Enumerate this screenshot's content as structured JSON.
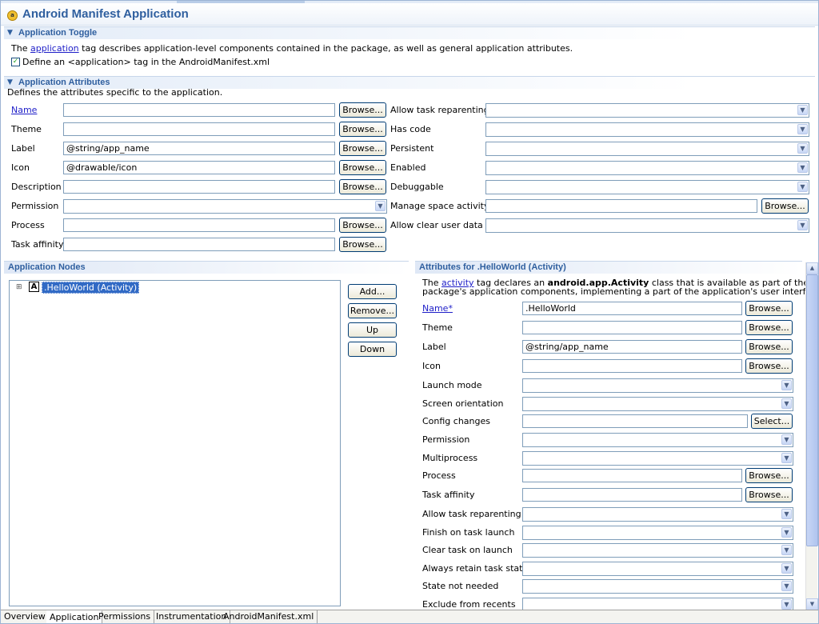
{
  "title": "Android Manifest Application",
  "toggle": {
    "header": "Application Toggle",
    "desc_pre": "The",
    "desc_link": "application",
    "desc_post": "tag describes application-level components contained in the package, as well as general application attributes.",
    "checkbox_label": "Define an <application> tag in the AndroidManifest.xml",
    "checked": true
  },
  "attrs": {
    "header": "Application Attributes",
    "desc": "Defines the attributes specific to the application.",
    "browse": "Browse...",
    "left": [
      {
        "label": "Name",
        "value": "",
        "kind": "text",
        "link": true
      },
      {
        "label": "Theme",
        "value": "",
        "kind": "text"
      },
      {
        "label": "Label",
        "value": "@string/app_name",
        "kind": "text"
      },
      {
        "label": "Icon",
        "value": "@drawable/icon",
        "kind": "text"
      },
      {
        "label": "Description",
        "value": "",
        "kind": "text"
      },
      {
        "label": "Permission",
        "value": "",
        "kind": "combo"
      },
      {
        "label": "Process",
        "value": "",
        "kind": "text"
      },
      {
        "label": "Task affinity",
        "value": "",
        "kind": "text"
      }
    ],
    "right": [
      {
        "label": "Allow task reparenting",
        "value": "",
        "kind": "combo"
      },
      {
        "label": "Has code",
        "value": "",
        "kind": "combo"
      },
      {
        "label": "Persistent",
        "value": "",
        "kind": "combo"
      },
      {
        "label": "Enabled",
        "value": "",
        "kind": "combo"
      },
      {
        "label": "Debuggable",
        "value": "",
        "kind": "combo"
      },
      {
        "label": "Manage space activity",
        "value": "",
        "kind": "text"
      },
      {
        "label": "Allow clear user data",
        "value": "",
        "kind": "combo"
      }
    ]
  },
  "nodes": {
    "header": "Application Nodes",
    "tree_item": ".HelloWorld (Activity)",
    "tree_badge": "A",
    "buttons": {
      "add": "Add...",
      "remove": "Remove...",
      "up": "Up",
      "down": "Down"
    }
  },
  "activity": {
    "header": "Attributes for .HelloWorld (Activity)",
    "desc1_pre": "The",
    "desc1_link": "activity",
    "desc1_mid": "tag declares an",
    "desc1_bold": "android.app.Activity",
    "desc1_post": "class that is available as part of the",
    "desc2": "package's application components, implementing a part of the application's user interface.",
    "browse": "Browse...",
    "select": "Select...",
    "fields": [
      {
        "label": "Name*",
        "value": ".HelloWorld",
        "kind": "text",
        "link": true
      },
      {
        "label": "Theme",
        "value": "",
        "kind": "text"
      },
      {
        "label": "Label",
        "value": "@string/app_name",
        "kind": "text"
      },
      {
        "label": "Icon",
        "value": "",
        "kind": "text"
      },
      {
        "label": "Launch mode",
        "value": "",
        "kind": "combo"
      },
      {
        "label": "Screen orientation",
        "value": "",
        "kind": "combo"
      },
      {
        "label": "Config changes",
        "value": "",
        "kind": "select"
      },
      {
        "label": "Permission",
        "value": "",
        "kind": "combo"
      },
      {
        "label": "Multiprocess",
        "value": "",
        "kind": "combo"
      },
      {
        "label": "Process",
        "value": "",
        "kind": "text"
      },
      {
        "label": "Task affinity",
        "value": "",
        "kind": "text"
      },
      {
        "label": "Allow task reparenting",
        "value": "",
        "kind": "combo"
      },
      {
        "label": "Finish on task launch",
        "value": "",
        "kind": "combo"
      },
      {
        "label": "Clear task on launch",
        "value": "",
        "kind": "combo"
      },
      {
        "label": "Always retain task state",
        "value": "",
        "kind": "combo"
      },
      {
        "label": "State not needed",
        "value": "",
        "kind": "combo"
      },
      {
        "label": "Exclude from recents",
        "value": "",
        "kind": "combo"
      }
    ]
  },
  "tabs": [
    "Overview",
    "Application",
    "Permissions",
    "Instrumentation",
    "AndroidManifest.xml"
  ],
  "active_tab": "Application",
  "colors": {
    "title": "#2f5f9f",
    "link": "#1e1ec8",
    "border": "#7f9db9"
  }
}
